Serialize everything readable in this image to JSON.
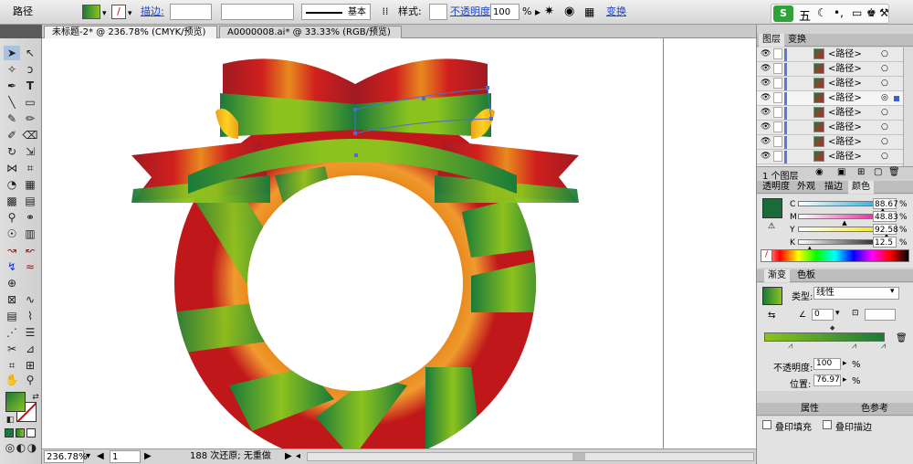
{
  "control_bar": {
    "selection_type": "路径",
    "stroke_label": "描边:",
    "stroke_style_label": "基本",
    "style_label": "样式:",
    "opacity_label": "不透明度:",
    "opacity_value": "100",
    "opacity_unit": "%",
    "transform_label": "变换"
  },
  "ime": {
    "label": "五"
  },
  "doc_tabs": [
    {
      "label": "未标题-2* @ 236.78% (CMYK/预览)"
    },
    {
      "label": "A0000008.ai* @ 33.33% (RGB/预览)"
    }
  ],
  "status_bar": {
    "zoom": "236.78%",
    "page": "1",
    "info": "188 次还原; 无重做"
  },
  "layers_panel": {
    "tabs": [
      "图层",
      "变换"
    ],
    "rows": [
      {
        "name": "<路径>"
      },
      {
        "name": "<路径>"
      },
      {
        "name": "<路径>"
      },
      {
        "name": "<路径>"
      },
      {
        "name": "<路径>"
      },
      {
        "name": "<路径>"
      },
      {
        "name": "<路径>"
      },
      {
        "name": "<路径>"
      }
    ],
    "footer": "1 个图层"
  },
  "color_panel": {
    "tabs": [
      "透明度",
      "外观",
      "描边",
      "颜色"
    ],
    "channels": [
      {
        "label": "C",
        "value": "88.67",
        "level": 0.8867
      },
      {
        "label": "M",
        "value": "48.83",
        "level": 0.4883
      },
      {
        "label": "Y",
        "value": "92.58",
        "level": 0.9258
      },
      {
        "label": "K",
        "value": "12.5",
        "level": 0.125
      }
    ],
    "unit": "%",
    "fill_color": "#1a6a3a"
  },
  "gradient_panel": {
    "tabs": [
      "渐变",
      "色板"
    ],
    "type_label": "类型:",
    "type_value": "线性",
    "angle_value": "0",
    "opacity_label": "不透明度:",
    "opacity_value": "100",
    "location_label": "位置:",
    "location_value": "76.97",
    "unit": "%"
  },
  "bottom_panel": {
    "overprint_fill": "叠印填充",
    "overprint_stroke": "叠印描边",
    "tab_a": "属性",
    "tab_b": "色参考"
  },
  "colors": {
    "red": "#d0201e",
    "orange": "#e88a1e",
    "green": "#1a7a3a",
    "lime": "#8cc21e",
    "yellow": "#ffd21e"
  }
}
